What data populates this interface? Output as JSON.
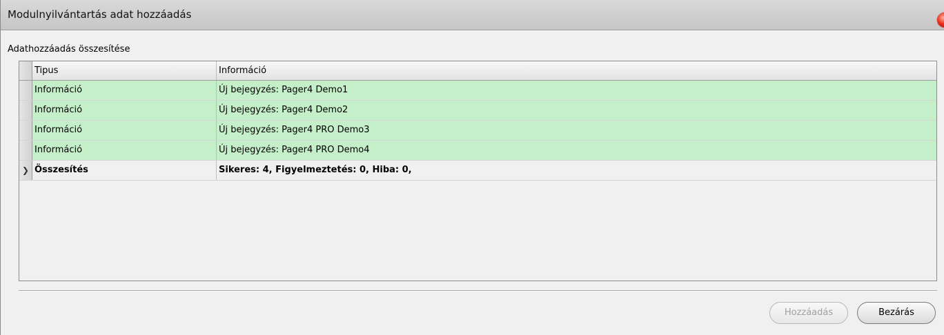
{
  "window": {
    "title": "Modulnyilvántartás adat hozzáadás"
  },
  "section_label": "Adathozzáadás összesítése",
  "grid": {
    "columns": [
      "Tipus",
      "Információ"
    ],
    "rows": [
      {
        "type": "Információ",
        "info": "Új bejegyzés: Pager4 Demo1",
        "status": "success"
      },
      {
        "type": "Információ",
        "info": "Új bejegyzés: Pager4 Demo2",
        "status": "success"
      },
      {
        "type": "Információ",
        "info": "Új bejegyzés: Pager4 PRO Demo3",
        "status": "success"
      },
      {
        "type": "Információ",
        "info": "Új bejegyzés: Pager4 PRO Demo4",
        "status": "success"
      }
    ],
    "summary": {
      "type": "Összesítés",
      "info": "Sikeres: 4, Figyelmeztetés: 0, Hiba: 0,"
    }
  },
  "buttons": {
    "add_label": "Hozzáadás",
    "add_enabled": false,
    "close_label": "Bezárás"
  },
  "colors": {
    "success_row": "#c5efc9",
    "close_icon": "#e8301c"
  },
  "icons": {
    "close": "close-icon",
    "current_row": "row-pointer-icon"
  }
}
